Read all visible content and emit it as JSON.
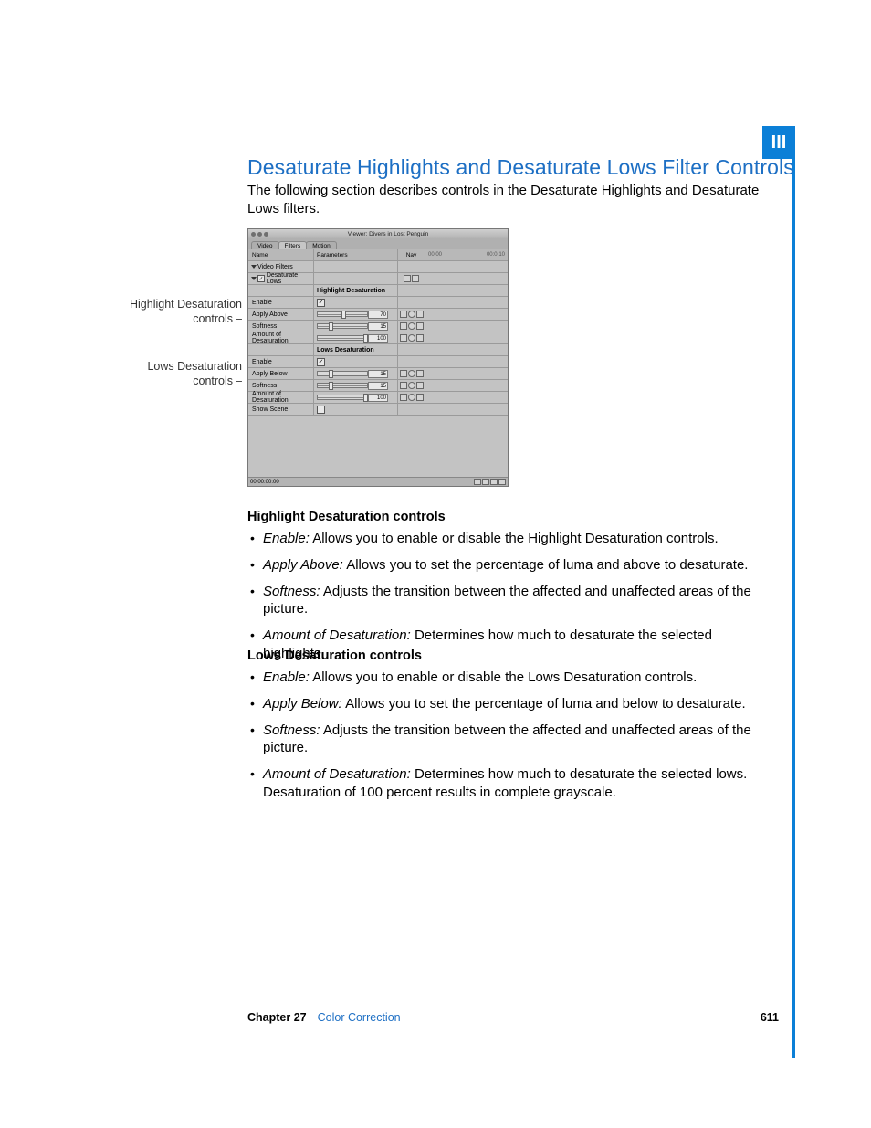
{
  "part_tab": "III",
  "heading": "Desaturate Highlights and Desaturate Lows Filter Controls",
  "intro": "The following section describes controls in the Desaturate Highlights and Desaturate Lows filters.",
  "callouts": {
    "highlight": "Highlight Desaturation controls",
    "lows": "Lows Desaturation controls"
  },
  "screenshot": {
    "window_title": "Viewer: Divers in Lost Penguin",
    "tabs": [
      "Video",
      "Filters",
      "Motion"
    ],
    "active_tab": 1,
    "columns": {
      "name": "Name",
      "param": "Parameters",
      "nav": "Nav",
      "tl_start": "00:00",
      "tl_end": "00:0:10"
    },
    "rows_top": [
      {
        "name": "Video Filters",
        "indent": 0,
        "tri": "down"
      },
      {
        "name": "Desaturate Lows",
        "indent": 1,
        "tri": "down",
        "checked": true,
        "nav_reset": true
      }
    ],
    "section_hi": "Highlight Desaturation",
    "rows_hi": [
      {
        "name": "Enable",
        "type": "check",
        "checked": true
      },
      {
        "name": "Apply Above",
        "type": "slider",
        "value": 70,
        "thumb": 26
      },
      {
        "name": "Softness",
        "type": "slider",
        "value": 15,
        "thumb": 12
      },
      {
        "name": "Amount of Desaturation",
        "type": "slider",
        "value": 100,
        "thumb": 50
      }
    ],
    "section_lo": "Lows Desaturation",
    "rows_lo": [
      {
        "name": "Enable",
        "type": "check",
        "checked": true
      },
      {
        "name": "Apply Below",
        "type": "slider",
        "value": 15,
        "thumb": 12
      },
      {
        "name": "Softness",
        "type": "slider",
        "value": 15,
        "thumb": 12
      },
      {
        "name": "Amount of Desaturation",
        "type": "slider",
        "value": 100,
        "thumb": 50
      },
      {
        "name": "Show Scene",
        "type": "check",
        "checked": false
      }
    ],
    "timecode": "00:00:00:00"
  },
  "sections": {
    "hi": {
      "title": "Highlight Desaturation controls",
      "items": [
        {
          "term": "Enable:",
          "desc": "Allows you to enable or disable the Highlight Desaturation controls."
        },
        {
          "term": "Apply Above:",
          "desc": "Allows you to set the percentage of luma and above to desaturate."
        },
        {
          "term": "Softness:",
          "desc": "Adjusts the transition between the affected and unaffected areas of the picture."
        },
        {
          "term": "Amount of Desaturation:",
          "desc": "Determines how much to desaturate the selected highlights."
        }
      ]
    },
    "lo": {
      "title": "Lows Desaturation controls",
      "items": [
        {
          "term": "Enable:",
          "desc": "Allows you to enable or disable the Lows Desaturation controls."
        },
        {
          "term": "Apply Below:",
          "desc": "Allows you to set the percentage of luma and below to desaturate."
        },
        {
          "term": "Softness:",
          "desc": "Adjusts the transition between the affected and unaffected areas of the picture."
        },
        {
          "term": "Amount of Desaturation:",
          "desc": "Determines how much to desaturate the selected lows. Desaturation of 100 percent results in complete grayscale."
        }
      ]
    }
  },
  "footer": {
    "chapter_label": "Chapter 27",
    "chapter_title": "Color Correction",
    "page": "611"
  }
}
